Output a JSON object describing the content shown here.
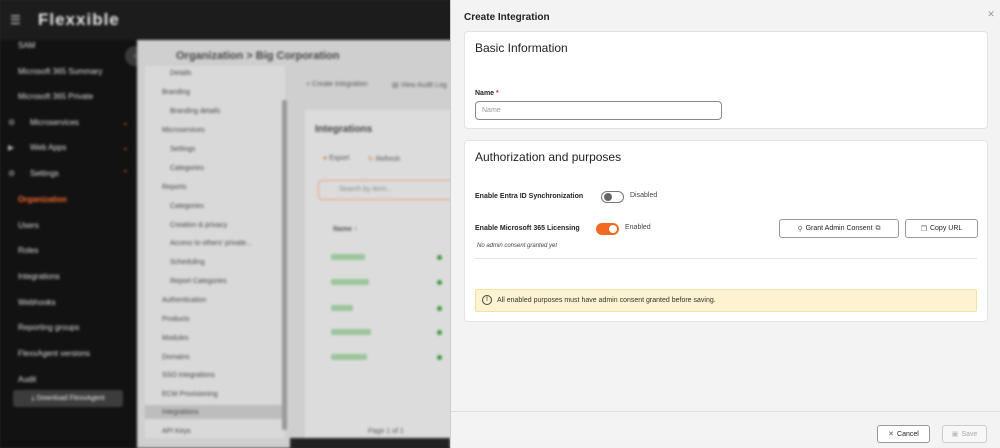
{
  "background": {
    "logo": "Flexxible",
    "menu_icon": "hamburger-menu-icon",
    "breadcrumb": "Organization  >  Big Corporation",
    "sidebar_items": [
      {
        "label": "SAM",
        "active": false
      },
      {
        "label": "Microsoft 365 Summary",
        "active": false
      },
      {
        "label": "Microsoft 365 Private",
        "active": false
      },
      {
        "label": "Microservices",
        "active": false
      },
      {
        "label": "Web Apps",
        "active": false
      },
      {
        "label": "Settings",
        "active": false
      },
      {
        "label": "Organization",
        "active": true
      },
      {
        "label": "Users",
        "active": false
      },
      {
        "label": "Roles",
        "active": false
      },
      {
        "label": "Integrations",
        "active": false
      },
      {
        "label": "Webhooks",
        "active": false
      },
      {
        "label": "Reporting groups",
        "active": false
      },
      {
        "label": "FlexxAgent versions",
        "active": false
      },
      {
        "label": "Audit",
        "active": false
      }
    ],
    "download_button": "Download FlexxAgent",
    "tree_items": [
      "Details",
      "Branding",
      "Branding details",
      "Microservices",
      "Settings",
      "Categories",
      "Reports",
      "Categories",
      "Creation & privacy",
      "Access to others' private...",
      "Scheduling",
      "Report Categories",
      "Authentication",
      "Products",
      "Modules",
      "Domains",
      "SSO integrations",
      "ECM Provisioning",
      "Integrations",
      "API Keys"
    ],
    "toolbar": {
      "create": "Create integration",
      "audit": "View Audit Log"
    },
    "list_title": "Integrations",
    "list_actions": {
      "export": "Export",
      "refresh": "Refresh"
    },
    "search_placeholder": "Search by term...",
    "column_name": "Name",
    "pagination": "Page 1 of 1"
  },
  "drawer": {
    "title": "Create Integration",
    "close_icon": "close-icon",
    "basic": {
      "heading": "Basic Information",
      "name_label": "Name",
      "required_mark": "*",
      "name_value": "",
      "name_placeholder": "Name"
    },
    "auth": {
      "heading": "Authorization and purposes",
      "entra": {
        "label": "Enable Entra ID Synchronization",
        "enabled": false,
        "state": "Disabled"
      },
      "m365": {
        "label": "Enable Microsoft 365 Licensing",
        "enabled": true,
        "state": "Enabled"
      },
      "consent_hint": "No admin consent granted yet",
      "grant_button": "Grant Admin Consent",
      "copy_button": "Copy URL",
      "alert": "All enabled purposes must have admin consent granted before saving."
    },
    "footer": {
      "cancel": "Cancel",
      "save": "Save"
    }
  },
  "colors": {
    "accent": "#f26a21",
    "alert_bg": "#fdf3d1",
    "active_nav": "#ff6a2a"
  }
}
